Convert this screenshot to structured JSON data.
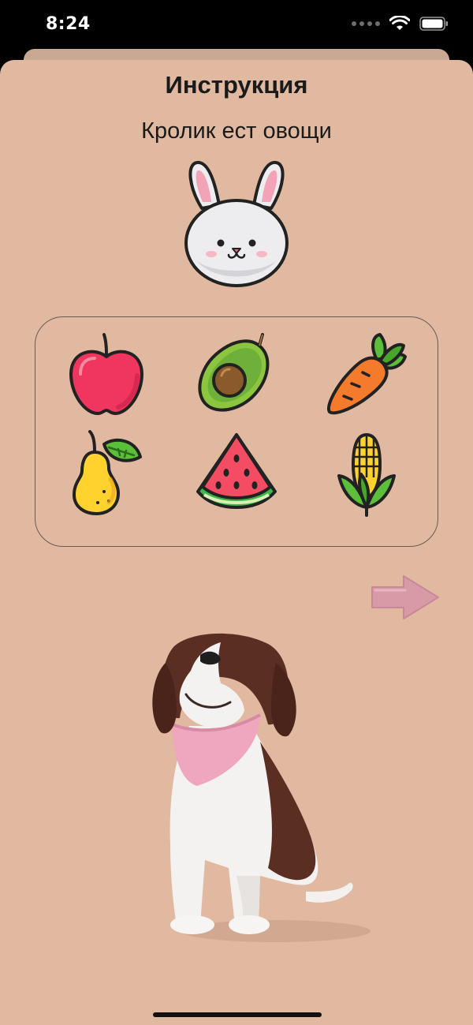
{
  "status_bar": {
    "time": "8:24",
    "icons": [
      "signal-icon",
      "wifi-icon",
      "battery-icon"
    ]
  },
  "sheet": {
    "title": "Инструкция",
    "subtitle": "Кролик ест овощи"
  },
  "character": {
    "icon": "bunny-icon"
  },
  "food_items": [
    {
      "icon": "apple-icon"
    },
    {
      "icon": "avocado-icon"
    },
    {
      "icon": "carrot-icon"
    },
    {
      "icon": "pear-icon"
    },
    {
      "icon": "watermelon-icon"
    },
    {
      "icon": "corn-icon"
    }
  ],
  "navigation": {
    "next_icon": "arrow-right-icon"
  },
  "mascot": {
    "icon": "dog-mascot"
  },
  "colors": {
    "background": "#e1b9a1",
    "arrow": "#d79aa6",
    "text": "#1a1a1a"
  }
}
